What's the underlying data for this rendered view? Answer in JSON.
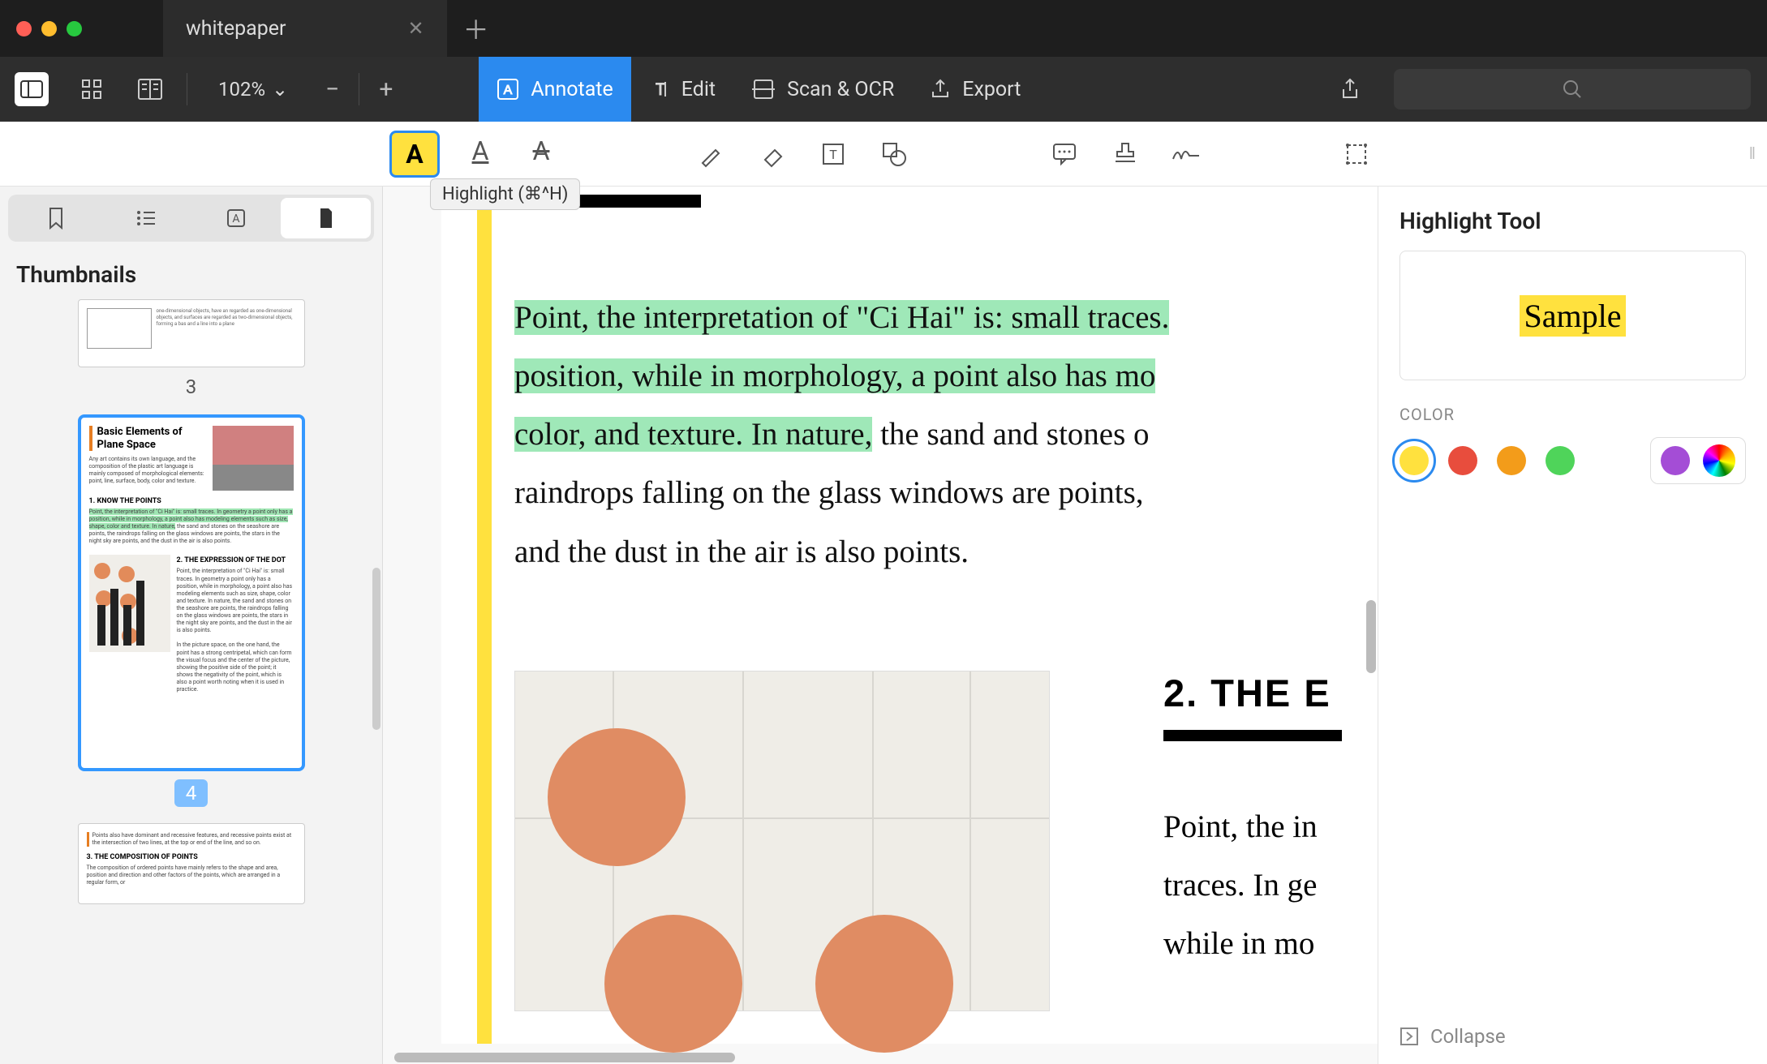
{
  "titlebar": {
    "tab_title": "whitepaper"
  },
  "toolbar": {
    "zoom": "102%",
    "annotate": "Annotate",
    "edit": "Edit",
    "scan_ocr": "Scan & OCR",
    "export": "Export"
  },
  "annot": {
    "tooltip": "Highlight (⌘^H)"
  },
  "sidebar": {
    "title": "Thumbnails",
    "pages": [
      {
        "num": "3"
      },
      {
        "num": "4",
        "selected": true,
        "title": "Basic Elements of Plane Space",
        "h1": "1. KNOW THE POINTS",
        "h2": "2. THE EXPRESSION OF THE DOT"
      }
    ]
  },
  "doc": {
    "p1_hl": "Point, the interpretation of \"Ci Hai\" is: small traces.",
    "p1_hl2": "position, while in morphology, a point also has mo",
    "p1_hl3": "color, and texture. In nature,",
    "p1_rest": " the sand and stones o",
    "p1_line4": "raindrops falling on the glass windows are points,",
    "p1_line5": "and the dust in the air is also points.",
    "h2": "2. THE E",
    "c2_l1": "Point, the in",
    "c2_l2": "traces. In ge",
    "c2_l3": "while in mo"
  },
  "right": {
    "title": "Highlight Tool",
    "sample": "Sample",
    "color_label": "COLOR",
    "collapse": "Collapse",
    "colors": {
      "yellow": "#ffe13e",
      "red": "#e84d3d",
      "orange": "#f39c1a",
      "green": "#4fd45a",
      "purple": "#a44dd6"
    }
  }
}
